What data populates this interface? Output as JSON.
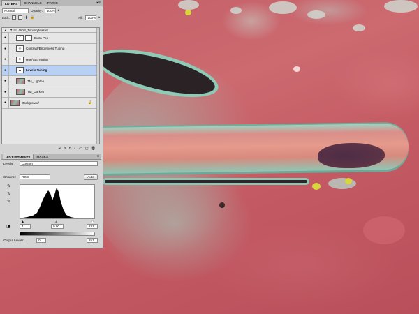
{
  "layers_panel": {
    "tabs": [
      "LAYERS",
      "CHANNELS",
      "PATHS"
    ],
    "active_tab": "LAYERS",
    "blend_mode": "Normal",
    "opacity_label": "Opacity:",
    "opacity_value": "100%",
    "lock_label": "Lock:",
    "fill_label": "Fill:",
    "fill_value": "100%",
    "group_name": "OOP_TonalityMaster",
    "layers": [
      {
        "name": "Extra Pop",
        "selected": false,
        "icon": "curves-icon"
      },
      {
        "name": "Contrast/Brightness Tuning",
        "selected": false,
        "icon": "brightness-icon"
      },
      {
        "name": "Hue/Sat Tuning",
        "selected": false,
        "icon": "hue-sat-icon"
      },
      {
        "name": "Levels Tuning",
        "selected": true,
        "icon": "levels-icon"
      },
      {
        "name": "TM_Lighten",
        "selected": false,
        "icon": "pixel-layer-icon"
      },
      {
        "name": "TM_Darken",
        "selected": false,
        "icon": "pixel-layer-icon"
      },
      {
        "name": "Background",
        "selected": false,
        "icon": "pixel-layer-icon"
      }
    ]
  },
  "adjustments_panel": {
    "tabs": [
      "ADJUSTMENTS",
      "MASKS"
    ],
    "active_tab": "ADJUSTMENTS",
    "title": "Levels",
    "preset": "Custom",
    "channel_label": "Channel:",
    "channel_value": "RGB",
    "auto_button": "Auto",
    "input_black": "4",
    "input_gamma": "0.90",
    "input_white": "231",
    "output_label": "Output Levels:",
    "output_black": "0",
    "output_white": "251"
  },
  "colors": {
    "panel_bg": "#d4d4d4",
    "selection": "#b7d0f3",
    "paint_red": "#c35e66",
    "patina_teal": "#8fcab6"
  }
}
